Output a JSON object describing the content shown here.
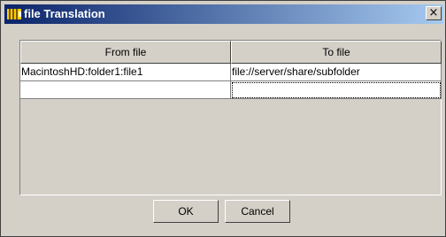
{
  "window": {
    "title": "file Translation",
    "close_glyph": "×",
    "icon": "app-icon"
  },
  "table": {
    "columns": [
      "From file",
      "To file"
    ],
    "rows": [
      [
        "MacintoshHD:folder1:file1",
        "file://server/share/subfolder"
      ],
      [
        "",
        ""
      ]
    ]
  },
  "buttons": {
    "ok": "OK",
    "cancel": "Cancel"
  }
}
